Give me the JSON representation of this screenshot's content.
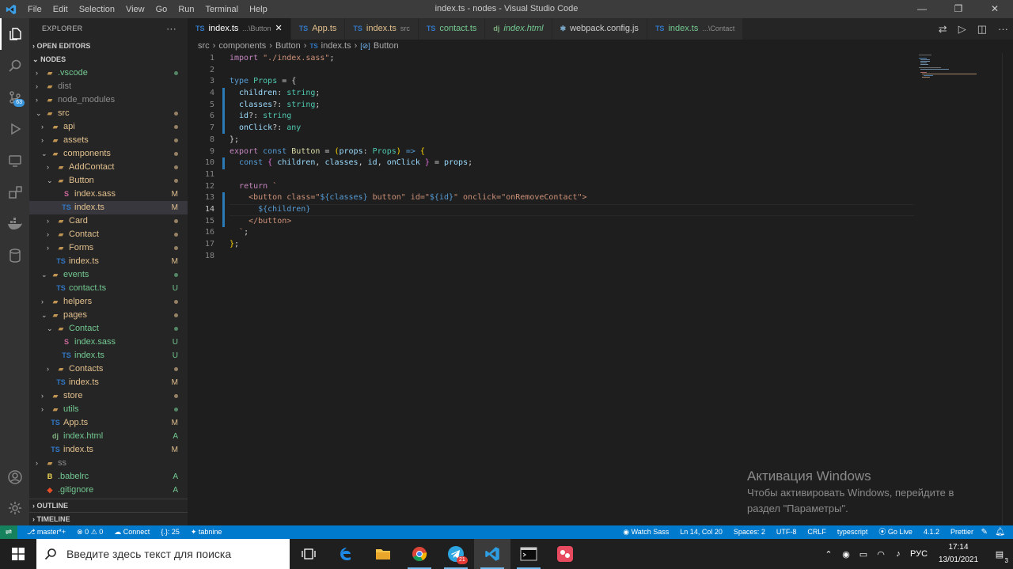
{
  "app": {
    "title": "index.ts - nodes - Visual Studio Code",
    "menu": [
      "File",
      "Edit",
      "Selection",
      "View",
      "Go",
      "Run",
      "Terminal",
      "Help"
    ],
    "accent": "#007acc"
  },
  "activity_bar": {
    "items": [
      {
        "icon": "files-icon",
        "active": true
      },
      {
        "icon": "search-icon"
      },
      {
        "icon": "source-control-icon",
        "badge": "63"
      },
      {
        "icon": "run-debug-icon"
      },
      {
        "icon": "remote-explorer-icon"
      },
      {
        "icon": "extensions-icon"
      },
      {
        "icon": "docker-icon"
      },
      {
        "icon": "database-icon"
      }
    ],
    "bottom": [
      {
        "icon": "account-icon"
      },
      {
        "icon": "settings-gear-icon"
      }
    ]
  },
  "sidebar": {
    "title": "EXPLORER",
    "more": "···",
    "open_editors": "OPEN EDITORS",
    "root": "NODES",
    "tree": [
      {
        "label": ".vscode",
        "type": "folder",
        "depth": 0,
        "open": false,
        "decoration": "dot",
        "color": "unt"
      },
      {
        "label": "dist",
        "type": "folder",
        "depth": 0,
        "open": false,
        "decoration": "",
        "color": "dim"
      },
      {
        "label": "node_modules",
        "type": "folder",
        "depth": 0,
        "open": false,
        "decoration": "",
        "color": "dim"
      },
      {
        "label": "src",
        "type": "folder",
        "depth": 0,
        "open": true,
        "decoration": "dot",
        "color": "mod"
      },
      {
        "label": "api",
        "type": "folder",
        "depth": 1,
        "open": false,
        "decoration": "dot",
        "color": "mod"
      },
      {
        "label": "assets",
        "type": "folder",
        "depth": 1,
        "open": false,
        "decoration": "dot",
        "color": "mod"
      },
      {
        "label": "components",
        "type": "folder",
        "depth": 1,
        "open": true,
        "decoration": "dot",
        "color": "mod"
      },
      {
        "label": "AddContact",
        "type": "folder",
        "depth": 2,
        "open": false,
        "decoration": "dot",
        "color": "mod"
      },
      {
        "label": "Button",
        "type": "folder",
        "depth": 2,
        "open": true,
        "decoration": "dot",
        "color": "mod"
      },
      {
        "label": "index.sass",
        "type": "sass",
        "depth": 3,
        "decoration": "M",
        "color": "mod"
      },
      {
        "label": "index.ts",
        "type": "ts",
        "depth": 3,
        "decoration": "M",
        "color": "mod",
        "selected": true
      },
      {
        "label": "Card",
        "type": "folder",
        "depth": 2,
        "open": false,
        "decoration": "dot",
        "color": "mod"
      },
      {
        "label": "Contact",
        "type": "folder",
        "depth": 2,
        "open": false,
        "decoration": "dot",
        "color": "mod"
      },
      {
        "label": "Forms",
        "type": "folder",
        "depth": 2,
        "open": false,
        "decoration": "dot",
        "color": "mod"
      },
      {
        "label": "index.ts",
        "type": "ts",
        "depth": 2,
        "decoration": "M",
        "color": "mod"
      },
      {
        "label": "events",
        "type": "folder",
        "depth": 1,
        "open": true,
        "decoration": "dot",
        "color": "unt"
      },
      {
        "label": "contact.ts",
        "type": "ts",
        "depth": 2,
        "decoration": "U",
        "color": "unt"
      },
      {
        "label": "helpers",
        "type": "folder",
        "depth": 1,
        "open": false,
        "decoration": "dot",
        "color": "mod"
      },
      {
        "label": "pages",
        "type": "folder",
        "depth": 1,
        "open": true,
        "decoration": "dot",
        "color": "mod"
      },
      {
        "label": "Contact",
        "type": "folder",
        "depth": 2,
        "open": true,
        "decoration": "dot",
        "color": "unt"
      },
      {
        "label": "index.sass",
        "type": "sass",
        "depth": 3,
        "decoration": "U",
        "color": "unt"
      },
      {
        "label": "index.ts",
        "type": "ts",
        "depth": 3,
        "decoration": "U",
        "color": "unt"
      },
      {
        "label": "Contacts",
        "type": "folder",
        "depth": 2,
        "open": false,
        "decoration": "dot",
        "color": "mod"
      },
      {
        "label": "index.ts",
        "type": "ts",
        "depth": 2,
        "decoration": "M",
        "color": "mod"
      },
      {
        "label": "store",
        "type": "folder",
        "depth": 1,
        "open": false,
        "decoration": "dot",
        "color": "mod"
      },
      {
        "label": "utils",
        "type": "folder",
        "depth": 1,
        "open": false,
        "decoration": "dot",
        "color": "unt"
      },
      {
        "label": "App.ts",
        "type": "ts",
        "depth": 1,
        "decoration": "M",
        "color": "mod"
      },
      {
        "label": "index.html",
        "type": "dj",
        "depth": 1,
        "decoration": "A",
        "color": "unt"
      },
      {
        "label": "index.ts",
        "type": "ts",
        "depth": 1,
        "decoration": "M",
        "color": "mod"
      },
      {
        "label": "ss",
        "type": "folder",
        "depth": 0,
        "open": false,
        "decoration": "",
        "color": "dim"
      },
      {
        "label": ".babelrc",
        "type": "babel",
        "depth": 0,
        "decoration": "A",
        "color": "unt"
      },
      {
        "label": ".gitignore",
        "type": "git",
        "depth": 0,
        "decoration": "A",
        "color": "unt"
      }
    ],
    "outline": "OUTLINE",
    "timeline": "TIMELINE"
  },
  "tabs": [
    {
      "label": "index.ts",
      "sub": "...\\Button",
      "icon": "ts",
      "active": true,
      "color": "mod"
    },
    {
      "label": "App.ts",
      "sub": "",
      "icon": "ts",
      "color": "mod"
    },
    {
      "label": "index.ts",
      "sub": "src",
      "icon": "ts",
      "color": "mod"
    },
    {
      "label": "contact.ts",
      "sub": "",
      "icon": "ts",
      "color": "unt"
    },
    {
      "label": "index.html",
      "sub": "",
      "icon": "dj",
      "color": "unt"
    },
    {
      "label": "webpack.config.js",
      "sub": "",
      "icon": "gear",
      "color": "def"
    },
    {
      "label": "index.ts",
      "sub": "...\\Contact",
      "icon": "ts",
      "color": "unt"
    }
  ],
  "breadcrumb": [
    "src",
    "components",
    "Button",
    "index.ts",
    "Button"
  ],
  "editor": {
    "current_line": 14,
    "lines": [
      [
        [
          "import ",
          "kc"
        ],
        [
          "\"./index.sass\"",
          "s"
        ],
        [
          ";",
          "p"
        ]
      ],
      [],
      [
        [
          "type ",
          "k"
        ],
        [
          "Props",
          "t"
        ],
        [
          " = {",
          "p"
        ]
      ],
      [
        [
          "  children",
          "v"
        ],
        [
          ": ",
          "p"
        ],
        [
          "string",
          "t"
        ],
        [
          ";",
          "p"
        ]
      ],
      [
        [
          "  classes",
          "v"
        ],
        [
          "?: ",
          "p"
        ],
        [
          "string",
          "t"
        ],
        [
          ";",
          "p"
        ]
      ],
      [
        [
          "  id",
          "v"
        ],
        [
          "?: ",
          "p"
        ],
        [
          "string",
          "t"
        ]
      ],
      [
        [
          "  onClick",
          "v"
        ],
        [
          "?: ",
          "p"
        ],
        [
          "any",
          "t"
        ]
      ],
      [
        [
          "};",
          "p"
        ]
      ],
      [
        [
          "export ",
          "kc"
        ],
        [
          "const ",
          "k"
        ],
        [
          "Button",
          "f"
        ],
        [
          " = ",
          "p"
        ],
        [
          "(",
          "y"
        ],
        [
          "props",
          "v"
        ],
        [
          ": ",
          "p"
        ],
        [
          "Props",
          "t"
        ],
        [
          "",
          "p"
        ],
        [
          ")",
          "y"
        ],
        [
          " => ",
          "k"
        ],
        [
          "{",
          "y"
        ]
      ],
      [
        [
          "  ",
          "p"
        ],
        [
          "const ",
          "k"
        ],
        [
          "{ ",
          "m"
        ],
        [
          "children",
          "v"
        ],
        [
          ", ",
          "p"
        ],
        [
          "classes",
          "v"
        ],
        [
          ", ",
          "p"
        ],
        [
          "id",
          "v"
        ],
        [
          ", ",
          "p"
        ],
        [
          "onClick",
          "v"
        ],
        [
          " }",
          "m"
        ],
        [
          " = ",
          "p"
        ],
        [
          "props",
          "v"
        ],
        [
          ";",
          "p"
        ]
      ],
      [],
      [
        [
          "  ",
          "p"
        ],
        [
          "return ",
          "kc"
        ],
        [
          "`",
          "s"
        ]
      ],
      [
        [
          "    <button class=\"",
          "s"
        ],
        [
          "${classes}",
          "k"
        ],
        [
          " button\" id=\"",
          "s"
        ],
        [
          "${id}",
          "k"
        ],
        [
          "\" onclick=\"onRemoveContact\">",
          "s"
        ]
      ],
      [
        [
          "      ",
          "p"
        ],
        [
          "${children}",
          "k"
        ]
      ],
      [
        [
          "    </button>",
          "s"
        ]
      ],
      [
        [
          "  `",
          "s"
        ],
        [
          ";",
          "p"
        ]
      ],
      [
        [
          "}",
          "y"
        ],
        [
          ";",
          "p"
        ]
      ],
      []
    ]
  },
  "watermark": {
    "line1": "Активация Windows",
    "line2": "Чтобы активировать Windows, перейдите в",
    "line3": "раздел \"Параметры\"."
  },
  "statusbar": {
    "left": [
      "master*+",
      "⊗ 0 ⚠ 0",
      "Connect",
      "{.}: 25",
      "tabnine"
    ],
    "right": [
      "Watch Sass",
      "Ln 14, Col 20",
      "Spaces: 2",
      "UTF-8",
      "CRLF",
      "typescript",
      "Go Live",
      "4.1.2",
      "Prettier"
    ]
  },
  "taskbar": {
    "search_placeholder": "Введите здесь текст для поиска",
    "language": "РУС",
    "time": "17:14",
    "date": "13/01/2021",
    "telegram_badge": "21",
    "notification_count": "3"
  }
}
